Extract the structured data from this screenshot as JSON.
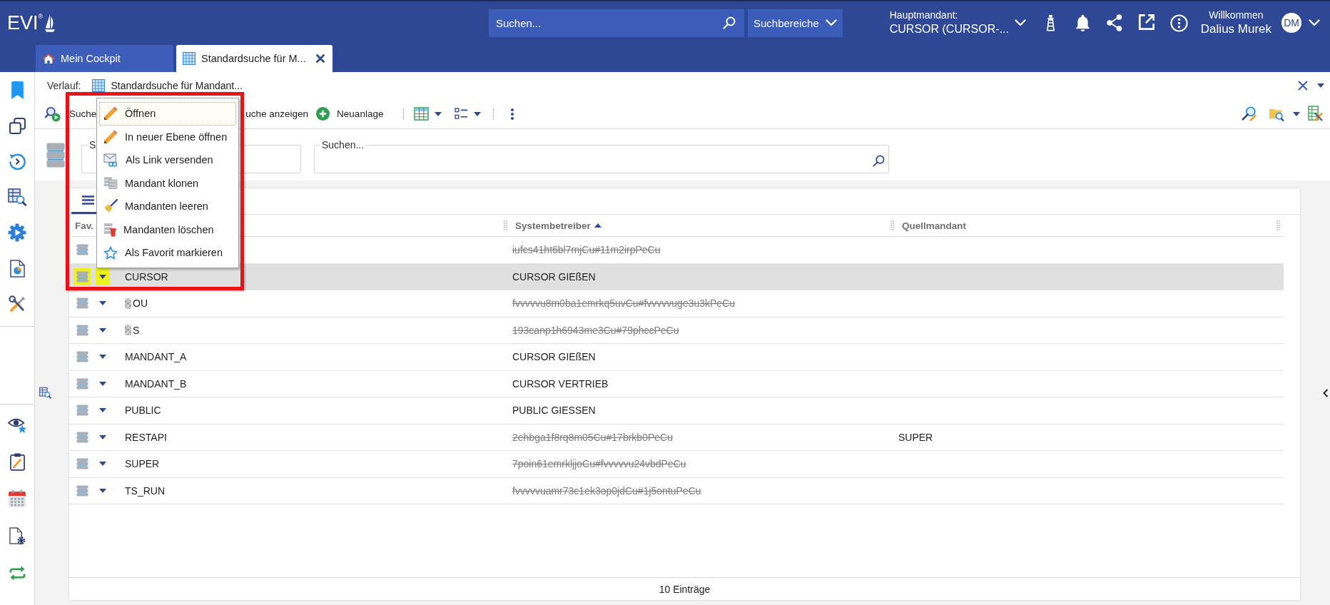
{
  "header": {
    "logo": "EVI$^{®}$",
    "search": {
      "placeholder": "Suchen..."
    },
    "scope_button": "Suchbereiche",
    "client": {
      "label": "Hauptmandant:",
      "value": "CURSOR (CURSOR-..."
    },
    "user": {
      "greeting": "Willkommen",
      "name": "Dalius Murek",
      "initials": "DM"
    }
  },
  "tabs": [
    {
      "label": "Mein Cockpit",
      "selected": false
    },
    {
      "label": "Standardsuche für M...",
      "selected": true
    }
  ],
  "history": {
    "label": "Verlauf:",
    "entry": "Standardsuche für Mandant..."
  },
  "toolbar": {
    "buttons": [
      {
        "label": "Suche"
      },
      {
        "label": "uche anzeigen"
      },
      {
        "label": "Neuanlage"
      }
    ]
  },
  "search_fields": [
    {
      "label": "S"
    },
    {
      "label": "Suchen..."
    }
  ],
  "table": {
    "view_tabs": [
      {
        "selected": true
      }
    ],
    "columns": [
      {
        "label": "Fav.",
        "sorted": false
      },
      {
        "label": "Systembetreiber",
        "sorted": true
      },
      {
        "label": "Quellmandant",
        "sorted": false
      }
    ],
    "rows": [
      {
        "systembetreiber": "iufcs41ht6bl7mjCu#11m2irpPeCu",
        "strikethrough": true,
        "selected": false,
        "redacted": false
      },
      {
        "column_2": "CURSOR",
        "systembetreiber": "CURSOR GIEßEN",
        "strikethrough": false,
        "selected": true,
        "redacted": false
      },
      {
        "column_2": "OU",
        "systembetreiber": "fvvvvvu8m0ba1emrkq5uvCu#fvvvvvuge3u3kPeCu",
        "strikethrough": true,
        "selected": false,
        "redacted": true
      },
      {
        "column_2": "S",
        "systembetreiber": "193canp1h6943me3Cu#79phccPeCu",
        "strikethrough": true,
        "selected": false,
        "redacted": true
      },
      {
        "column_2": "MANDANT_A",
        "systembetreiber": "CURSOR GIEßEN",
        "strikethrough": false,
        "selected": false,
        "redacted": false
      },
      {
        "column_2": "MANDANT_B",
        "systembetreiber": "CURSOR VERTRIEB",
        "strikethrough": false,
        "selected": false,
        "redacted": false
      },
      {
        "column_2": "PUBLIC",
        "systembetreiber": "PUBLIC GIESSEN",
        "strikethrough": false,
        "selected": false,
        "redacted": false
      },
      {
        "column_2": "RESTAPI",
        "systembetreiber": "2ehbga1f8rq8m05Cu#17brkb0PeCu",
        "quellmandant": "SUPER",
        "strikethrough": true,
        "selected": false,
        "redacted": false
      },
      {
        "column_2": "SUPER",
        "systembetreiber": "7poin61emrkljjoCu#fvvvvvu24vbdPeCu",
        "strikethrough": true,
        "selected": false,
        "redacted": false
      },
      {
        "column_2": "TS_RUN",
        "systembetreiber": "fvvvvvuamr73c1ek3op0jdCu#1j5ontuPeCu",
        "strikethrough": true,
        "selected": false,
        "redacted": false
      }
    ],
    "footer": "10 Einträge"
  },
  "context_menu": {
    "items": [
      {
        "label": "Öffnen",
        "focused": true
      },
      {
        "label": "In neuer Ebene öffnen",
        "focused": false
      },
      {
        "label": "Als Link versenden",
        "focused": false
      },
      {
        "label": "Mandant klonen",
        "focused": false
      },
      {
        "label": "Mandanten leeren",
        "focused": false
      },
      {
        "label": "Mandanten löschen",
        "focused": false
      },
      {
        "label": "Als Favorit markieren",
        "focused": false
      }
    ]
  }
}
